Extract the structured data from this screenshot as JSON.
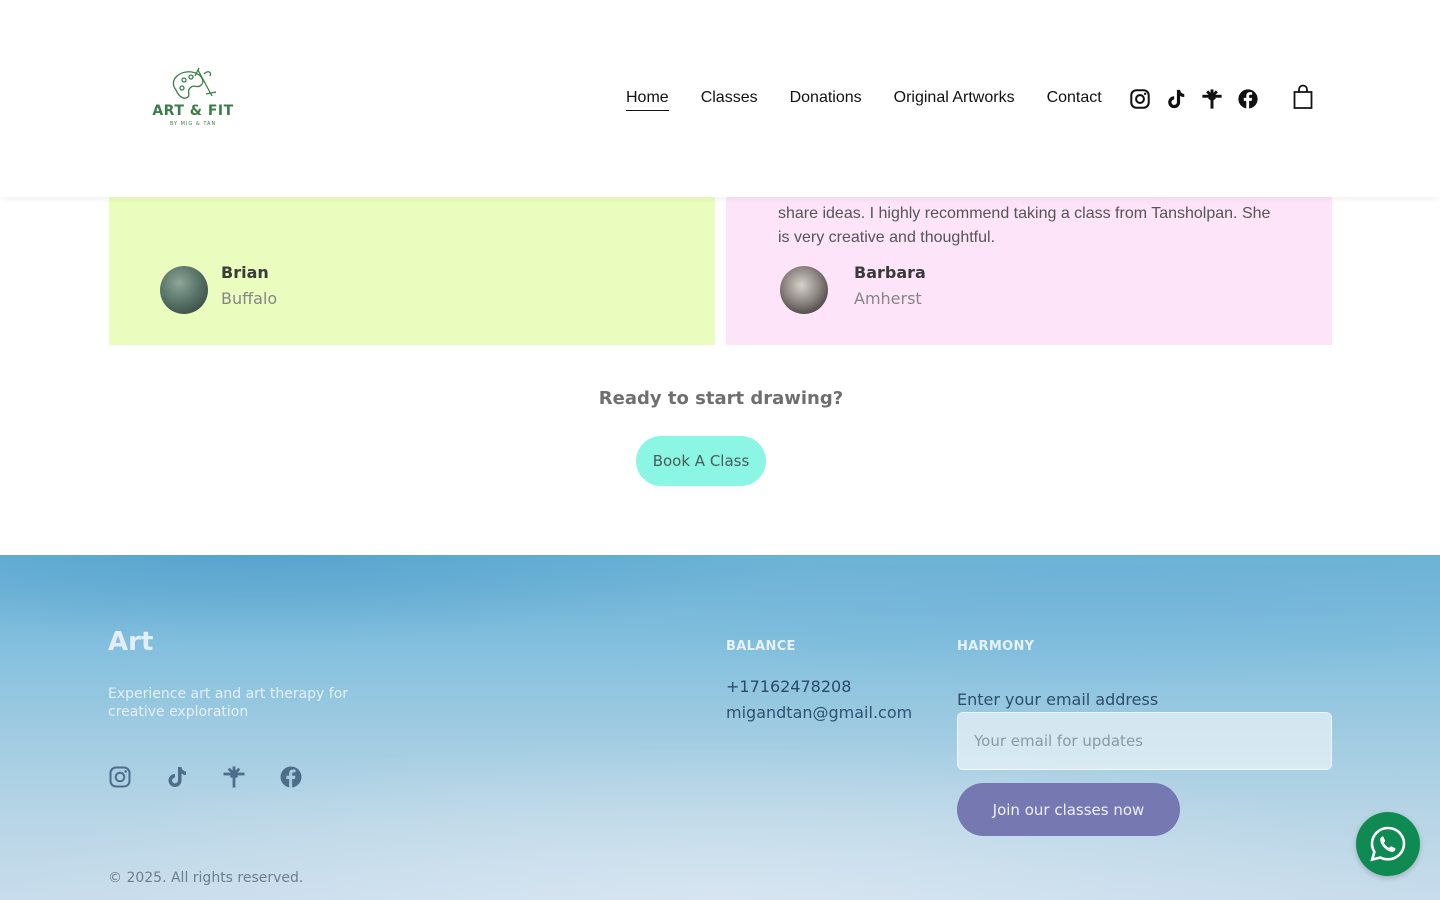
{
  "header": {
    "logo": {
      "title": "ART & FIT",
      "subtitle": "BY MIG & TAN"
    },
    "nav": [
      {
        "label": "Home",
        "active": true
      },
      {
        "label": "Classes"
      },
      {
        "label": "Donations"
      },
      {
        "label": "Original Artworks"
      },
      {
        "label": "Contact"
      }
    ],
    "social_icons": [
      "instagram-icon",
      "tiktok-icon",
      "linktree-icon",
      "facebook-icon"
    ],
    "cart_icon": "shopping-bag-icon"
  },
  "testimonials": [
    {
      "quote": "",
      "name": "Brian",
      "city": "Buffalo",
      "bg_color": "#ebfdbe"
    },
    {
      "quote": "share ideas. I highly recommend taking a class from Tansholpan. She is very creative and thoughtful.",
      "name": "Barbara",
      "city": "Amherst",
      "bg_color": "#fee4f9"
    }
  ],
  "cta": {
    "title": "Ready to start drawing?",
    "button_label": "Book A Class",
    "button_color": "#8cf6e4"
  },
  "footer": {
    "brand": "Art",
    "tagline": "Experience art and art therapy for creative exploration",
    "social_icons": [
      "instagram-icon",
      "tiktok-icon",
      "linktree-icon",
      "facebook-icon"
    ],
    "balance": {
      "title": "BALANCE",
      "phone": "+17162478208",
      "email": "migandtan@gmail.com"
    },
    "harmony": {
      "title": "HARMONY",
      "email_label": "Enter your email address",
      "email_placeholder": "Your email for updates",
      "button_label": "Join our classes now",
      "button_color": "#7678b2"
    },
    "copyright": "© 2025. All rights reserved."
  },
  "whatsapp": {
    "icon": "whatsapp-icon",
    "color": "#0f8a53"
  }
}
